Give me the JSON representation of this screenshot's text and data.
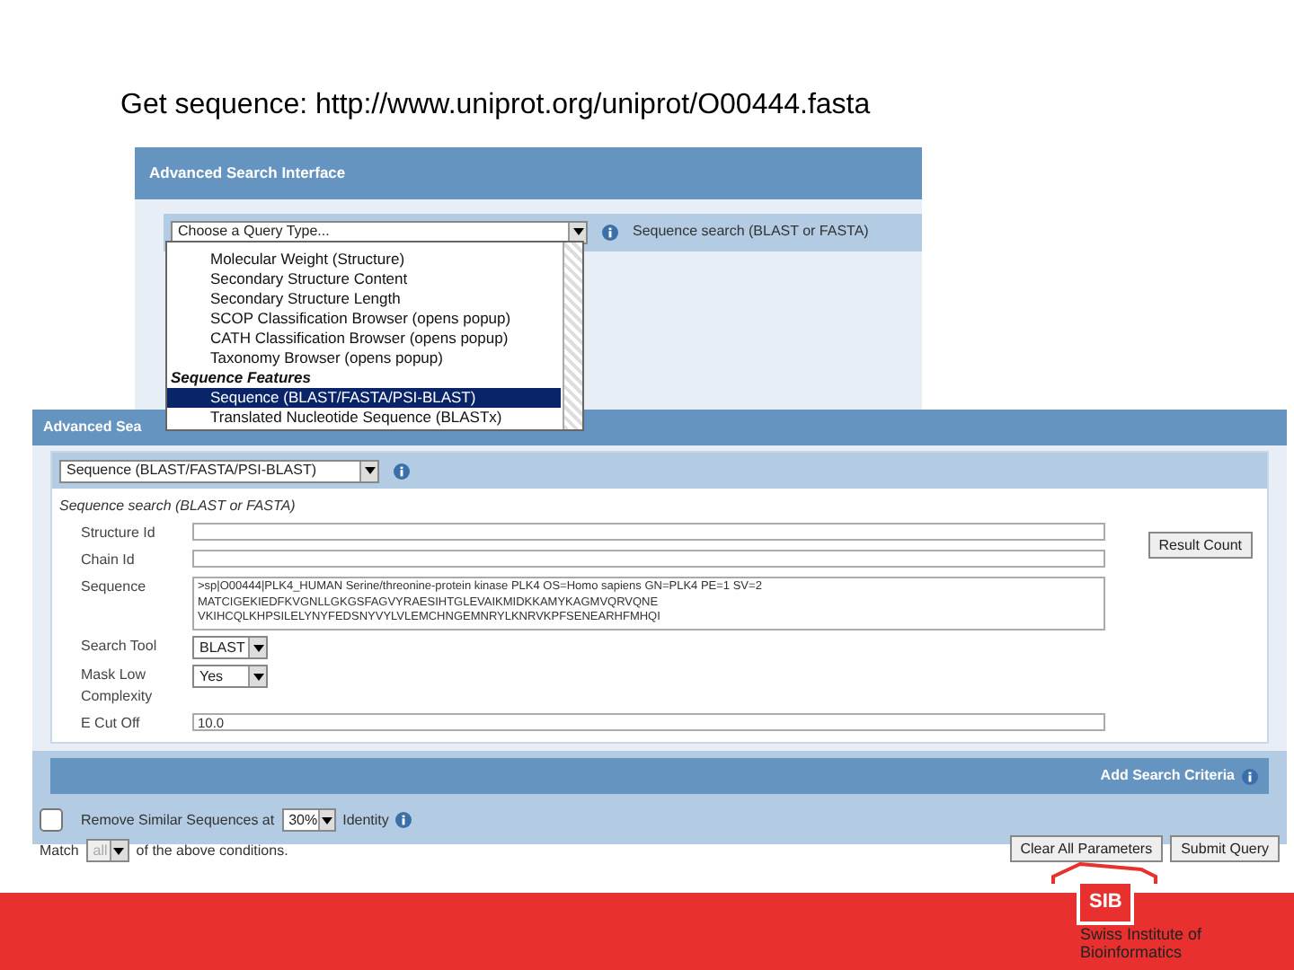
{
  "slide_title": "Get sequence: http://www.uniprot.org/uniprot/O00444.fasta",
  "back_window": {
    "title": "Advanced Search Interface",
    "query_select": "Choose a Query Type...",
    "query_hint": "Sequence search (BLAST or FASTA)",
    "dropdown": [
      {
        "kind": "option",
        "label": "Molecular Weight (Structure)",
        "selected": false
      },
      {
        "kind": "option",
        "label": "Secondary Structure Content",
        "selected": false
      },
      {
        "kind": "option",
        "label": "Secondary Structure Length",
        "selected": false
      },
      {
        "kind": "option",
        "label": "SCOP Classification Browser (opens popup)",
        "selected": false
      },
      {
        "kind": "option",
        "label": "CATH Classification Browser (opens popup)",
        "selected": false
      },
      {
        "kind": "option",
        "label": "Taxonomy Browser (opens popup)",
        "selected": false
      },
      {
        "kind": "group",
        "label": "Sequence Features"
      },
      {
        "kind": "option",
        "label": "Sequence (BLAST/FASTA/PSI-BLAST)",
        "selected": true
      },
      {
        "kind": "option",
        "label": "Translated Nucleotide Sequence (BLASTx)",
        "selected": false
      }
    ]
  },
  "front_window": {
    "tab": "Advanced Sea",
    "query_select": "Sequence (BLAST/FASTA/PSI-BLAST)",
    "section_label": "Sequence search (BLAST or FASTA)",
    "fields": [
      {
        "kind": "text",
        "label": "Structure Id"
      },
      {
        "kind": "text",
        "label": "Chain Id"
      },
      {
        "kind": "textarea",
        "label": "Sequence",
        "value": ">sp|O00444|PLK4_HUMAN Serine/threonine-protein kinase PLK4 OS=Homo sapiens GN=PLK4 PE=1 SV=2\nMATCIGEKIEDFKVGNLLGKGSFAGVYRAESIHTGLEVAIKMIDKKAMYKAGMVQRVQNE\nVKIHCQLKHPSILELYNYFEDSNYVYLVLEMCHNGEMNRYLKNRVKPFSENEARHFMHQI"
      },
      {
        "kind": "select",
        "label": "Search Tool",
        "value": "BLAST"
      },
      {
        "kind": "select",
        "label": "Mask Low Complexity",
        "value": "Yes"
      },
      {
        "kind": "text",
        "label": "E Cut Off",
        "value": "10.0"
      }
    ],
    "result_button": "Result Count",
    "add_criteria": "Add Search Criteria",
    "remove_similar": {
      "checked": false,
      "label": "Remove Similar Sequences at",
      "value": "30%",
      "suffix": "Identity"
    },
    "match": {
      "prefix": "Match",
      "value": "all",
      "suffix": "of the above conditions.",
      "disabled": true
    },
    "buttons": [
      "Clear All Parameters",
      "Submit Query"
    ]
  },
  "footer": {
    "logo_text": "SIB",
    "org": "Swiss Institute of Bioinformatics"
  }
}
